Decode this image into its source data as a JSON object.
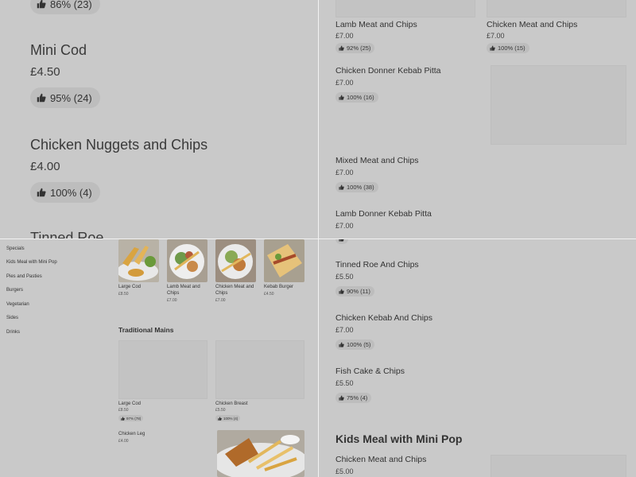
{
  "top_left": {
    "top_badge": "86% (23)",
    "items": [
      {
        "name": "Mini Cod",
        "price": "£4.50",
        "rating": "95% (24)"
      },
      {
        "name": "Chicken Nuggets and Chips",
        "price": "£4.00",
        "rating": "100% (4)"
      },
      {
        "name": "Tinned Roe"
      }
    ]
  },
  "top_right": {
    "cards": [
      {
        "name": "Lamb Meat and Chips",
        "price": "£7.00",
        "rating": "92% (25)"
      },
      {
        "name": "Chicken Meat and Chips",
        "price": "£7.00",
        "rating": "100% (15)"
      }
    ],
    "items": [
      {
        "name": "Chicken Donner Kebab Pitta",
        "price": "£7.00",
        "rating": "100% (16)"
      },
      {
        "name": "Mixed Meat and Chips",
        "price": "£7.00",
        "rating": "100% (38)"
      },
      {
        "name": "Lamb Donner Kebab Pitta",
        "price": "£7.00"
      }
    ]
  },
  "bottom_left": {
    "sidebar": [
      "Specials",
      "Kids Meal with Mini Pop",
      "Pies and Pasties",
      "Burgers",
      "Vegetarian",
      "Sides",
      "Drinks"
    ],
    "popular": [
      {
        "name": "Large Cod",
        "price": "£8.50"
      },
      {
        "name": "Lamb Meat and Chips",
        "price": "£7.00"
      },
      {
        "name": "Chicken Meat and Chips",
        "price": "£7.00"
      },
      {
        "name": "Kebab Burger",
        "price": "£4.50"
      }
    ],
    "section_title": "Traditional Mains",
    "mains": [
      {
        "name": "Large Cod",
        "price": "£8.50",
        "rating": "97% (78)"
      },
      {
        "name": "Chicken Breast",
        "price": "£5.50",
        "rating": "100% (4)"
      },
      {
        "name": "Chicken Leg",
        "price": "£4.00"
      }
    ]
  },
  "bottom_right": {
    "items": [
      {
        "name": "Tinned Roe And Chips",
        "price": "£5.50",
        "rating": "90% (11)"
      },
      {
        "name": "Chicken Kebab And Chips",
        "price": "£7.00",
        "rating": "100% (5)"
      },
      {
        "name": "Fish Cake & Chips",
        "price": "£5.50",
        "rating": "75% (4)"
      }
    ],
    "section_title": "Kids Meal with Mini Pop",
    "section_items": [
      {
        "name": "Chicken Meat and Chips",
        "price": "£5.00"
      }
    ]
  },
  "icons": {
    "rating": "thumbs-up-icon"
  },
  "colors": {
    "overlay": "#c8c8c8",
    "badge": "#bdbdbd",
    "divider": "#f2f2f2"
  }
}
